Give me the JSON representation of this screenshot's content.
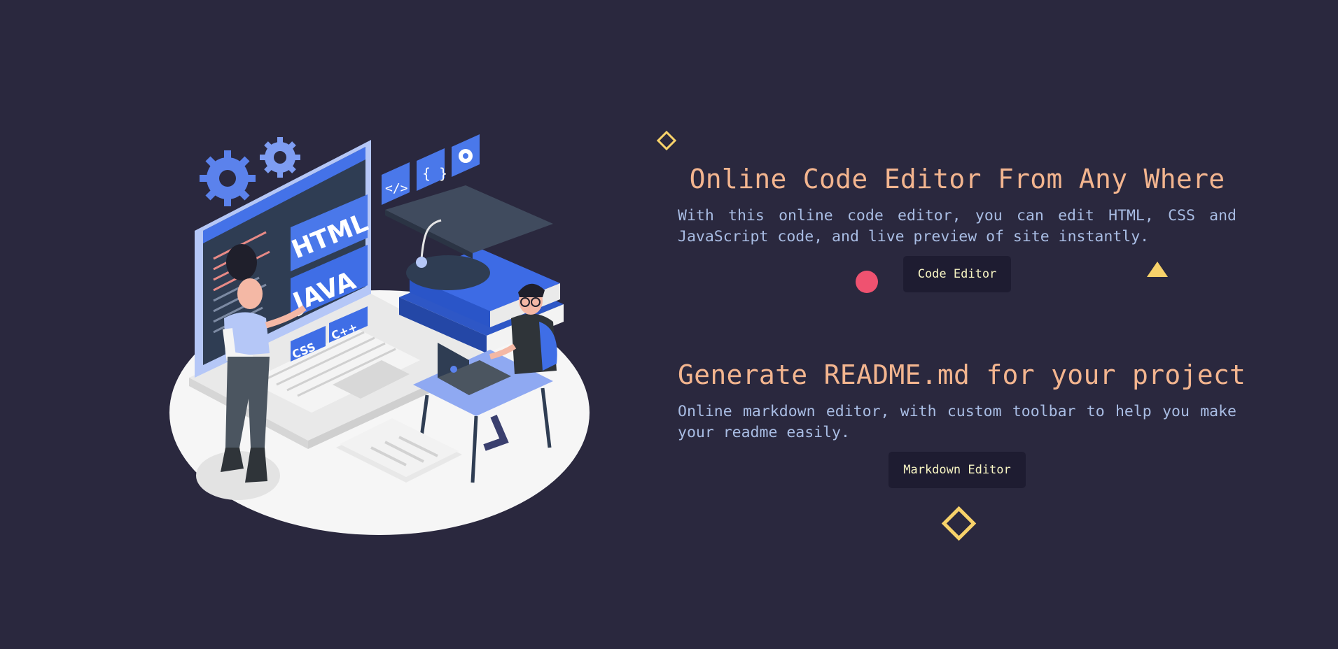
{
  "sections": [
    {
      "title": "Online Code Editor From Any Where",
      "description": "With this online code editor, you can edit HTML, CSS and JavaScript code, and live preview of site instantly.",
      "button_label": "Code Editor"
    },
    {
      "title": "Generate README.md for your project",
      "description": "Online markdown editor, with custom toolbar to help you make your readme easily.",
      "button_label": "Markdown Editor"
    }
  ],
  "illustration": {
    "badges": [
      "HTML",
      "JAVA",
      "C++",
      "CSS"
    ],
    "icons": [
      "code-tag-icon",
      "curly-braces-icon",
      "gear-icon"
    ]
  },
  "colors": {
    "background": "#2a283e",
    "title": "#f3b58f",
    "description": "#a9bde4",
    "button_bg": "#1e1c31",
    "button_text": "#f8f5c3",
    "accent_yellow": "#f7d26a",
    "accent_red": "#ef5270",
    "illustration_blue": "#3f6ee6"
  }
}
